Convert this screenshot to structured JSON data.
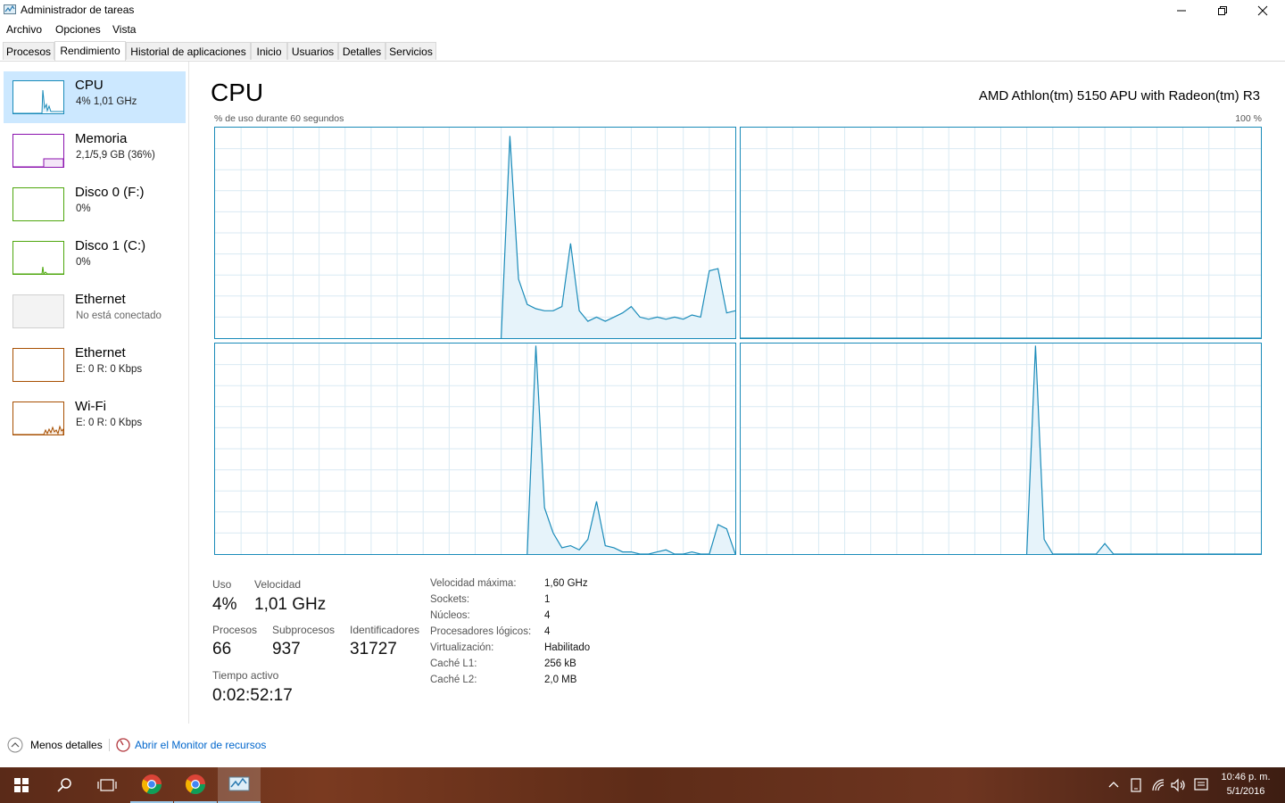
{
  "window": {
    "title": "Administrador de tareas"
  },
  "menu": [
    "Archivo",
    "Opciones",
    "Vista"
  ],
  "tabs": [
    "Procesos",
    "Rendimiento",
    "Historial de aplicaciones",
    "Inicio",
    "Usuarios",
    "Detalles",
    "Servicios"
  ],
  "sidebar": [
    {
      "name": "CPU",
      "sub": "4% 1,01 GHz"
    },
    {
      "name": "Memoria",
      "sub": "2,1/5,9 GB (36%)"
    },
    {
      "name": "Disco 0 (F:)",
      "sub": "0%"
    },
    {
      "name": "Disco 1 (C:)",
      "sub": "0%"
    },
    {
      "name": "Ethernet",
      "sub": "No está conectado"
    },
    {
      "name": "Ethernet",
      "sub": "E: 0 R: 0 Kbps"
    },
    {
      "name": "Wi-Fi",
      "sub": "E: 0 R: 0 Kbps"
    }
  ],
  "main": {
    "title": "CPU",
    "model": "AMD Athlon(tm) 5150 APU with Radeon(tm) R3",
    "graph_caption": "% de uso durante 60 segundos",
    "graph_max": "100 %"
  },
  "cores": [
    [
      0,
      0,
      0,
      0,
      0,
      0,
      0,
      0,
      0,
      0,
      0,
      0,
      0,
      0,
      0,
      0,
      0,
      0,
      0,
      0,
      0,
      0,
      0,
      0,
      0,
      0,
      0,
      0,
      0,
      0,
      0,
      0,
      0,
      0,
      96,
      28,
      16,
      14,
      13,
      13,
      15,
      45,
      13,
      8,
      10,
      8,
      10,
      12,
      15,
      10,
      9,
      10,
      9,
      10,
      9,
      11,
      10,
      32,
      33,
      12,
      13
    ],
    [
      0,
      0,
      0,
      0,
      0,
      0,
      0,
      0,
      0,
      0,
      0,
      0,
      0,
      0,
      0,
      0,
      0,
      0,
      0,
      0,
      0,
      0,
      0,
      0,
      0,
      0,
      0,
      0,
      0,
      0,
      0,
      0,
      0,
      0,
      0,
      0,
      0,
      0,
      0,
      0,
      0,
      0,
      0,
      0,
      0,
      0,
      0,
      0,
      0,
      0,
      0,
      0,
      0,
      0,
      0,
      0,
      0,
      0,
      0,
      0,
      0
    ],
    [
      0,
      0,
      0,
      0,
      0,
      0,
      0,
      0,
      0,
      0,
      0,
      0,
      0,
      0,
      0,
      0,
      0,
      0,
      0,
      0,
      0,
      0,
      0,
      0,
      0,
      0,
      0,
      0,
      0,
      0,
      0,
      0,
      0,
      0,
      99,
      22,
      10,
      3,
      4,
      2,
      7,
      25,
      4,
      3,
      1,
      1,
      0,
      0,
      1,
      2,
      0,
      0,
      1,
      0,
      0,
      14,
      12,
      0
    ],
    [
      0,
      0,
      0,
      0,
      0,
      0,
      0,
      0,
      0,
      0,
      0,
      0,
      0,
      0,
      0,
      0,
      0,
      0,
      0,
      0,
      0,
      0,
      0,
      0,
      0,
      0,
      0,
      0,
      0,
      0,
      0,
      0,
      0,
      0,
      99,
      7,
      0,
      0,
      0,
      0,
      0,
      0,
      5,
      0,
      0,
      0,
      0,
      0,
      0,
      0,
      0,
      0,
      0,
      0,
      0,
      0,
      0,
      0,
      0,
      0,
      0
    ]
  ],
  "stats": {
    "uso_label": "Uso",
    "uso_value": "4%",
    "velocidad_label": "Velocidad",
    "velocidad_value": "1,01 GHz",
    "procesos_label": "Procesos",
    "procesos_value": "66",
    "subprocesos_label": "Subprocesos",
    "subprocesos_value": "937",
    "identificadores_label": "Identificadores",
    "identificadores_value": "31727",
    "tiempo_label": "Tiempo activo",
    "tiempo_value": "0:02:52:17"
  },
  "specs": [
    {
      "label": "Velocidad máxima:",
      "value": "1,60 GHz"
    },
    {
      "label": "Sockets:",
      "value": "1"
    },
    {
      "label": "Núcleos:",
      "value": "4"
    },
    {
      "label": "Procesadores lógicos:",
      "value": "4"
    },
    {
      "label": "Virtualización:",
      "value": "Habilitado"
    },
    {
      "label": "Caché L1:",
      "value": "256 kB"
    },
    {
      "label": "Caché L2:",
      "value": "2,0 MB"
    }
  ],
  "footer": {
    "less_details": "Menos detalles",
    "resource_monitor": "Abrir el Monitor de recursos"
  },
  "taskbar": {
    "time": "10:46 p. m.",
    "date": "5/1/2016"
  },
  "colors": {
    "accent": "#1a8bb9",
    "selected": "#cce8ff",
    "link": "#0066cc",
    "memory": "#8b12ae",
    "disk": "#4da60c",
    "wifi": "#a74f01"
  }
}
